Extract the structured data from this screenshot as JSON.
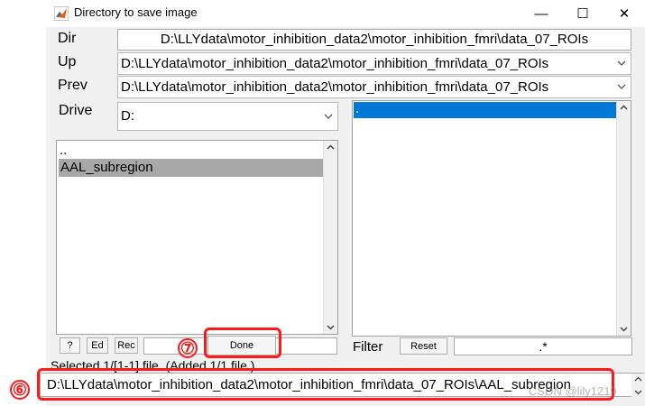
{
  "window": {
    "title": "Directory to save image",
    "minimize": "—",
    "maximize": "☐",
    "close": "✕"
  },
  "labels": {
    "dir": "Dir",
    "up": "Up",
    "prev": "Prev",
    "drive": "Drive",
    "filter": "Filter"
  },
  "fields": {
    "dir": "D:\\LLYdata\\motor_inhibition_data2\\motor_inhibition_fmri\\data_07_ROIs",
    "up": "D:\\LLYdata\\motor_inhibition_data2\\motor_inhibition_fmri\\data_07_ROIs",
    "prev": "D:\\LLYdata\\motor_inhibition_data2\\motor_inhibition_fmri\\data_07_ROIs",
    "drive": "D:",
    "filter": ".*"
  },
  "dir_list": {
    "items": [
      "..",
      "AAL_subregion"
    ],
    "selected_index": 1
  },
  "file_list": {
    "items": [
      "."
    ],
    "selected_index": 0
  },
  "buttons": {
    "help": "?",
    "edit": "Ed",
    "rec": "Rec",
    "done": "Done",
    "reset": "Reset"
  },
  "status": "Selected 1/[1-1] file. (Added 1/1 file.)",
  "selected_path": "D:\\LLYdata\\motor_inhibition_data2\\motor_inhibition_fmri\\data_07_ROIs\\AAL_subregion",
  "annotations": {
    "marker_6": "⑥",
    "marker_7": "⑦",
    "watermark": "CSDN @lily1219"
  },
  "colors": {
    "selection_blue": "#0078d7",
    "selection_gray": "#a8a8a8",
    "highlight_red": "#ff1a1a"
  }
}
